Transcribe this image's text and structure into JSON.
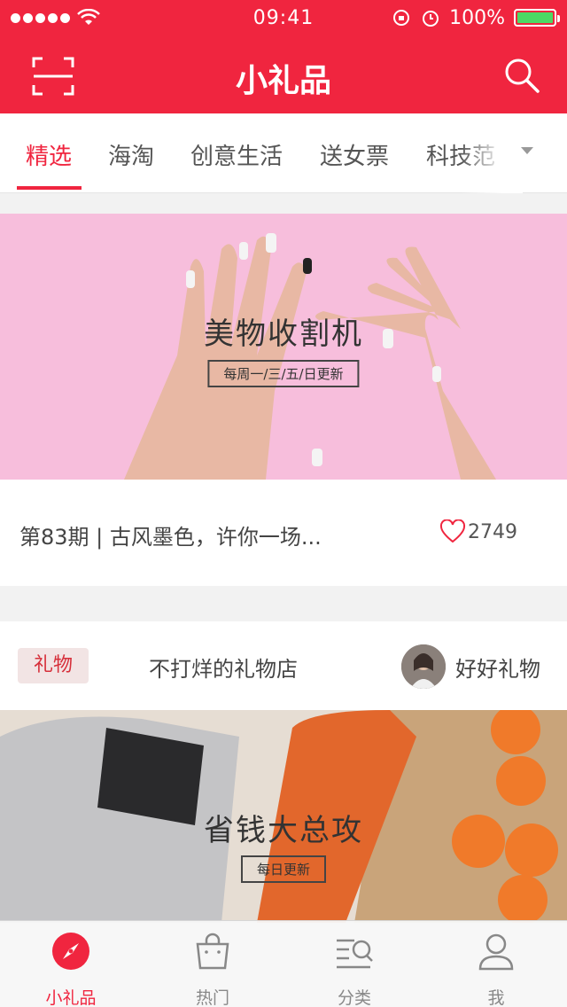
{
  "status_bar": {
    "time": "09:41",
    "battery": "100%"
  },
  "nav": {
    "title": "小礼品"
  },
  "tabs": [
    {
      "label": "精选",
      "active": true
    },
    {
      "label": "海淘"
    },
    {
      "label": "创意生活"
    },
    {
      "label": "送女票"
    },
    {
      "label": "科技范"
    }
  ],
  "feature": {
    "banner_title": "美物收割机",
    "banner_tag": "每周一/三/五/日更新",
    "title": "第83期 | 古风墨色，许你一场...",
    "likes": "2749"
  },
  "post": {
    "badge": "礼物",
    "shop": "不打烊的礼物店",
    "author": "好好礼物",
    "banner_title": "省钱大总攻",
    "banner_tag": "每日更新"
  },
  "tab_bar": [
    {
      "label": "小礼品",
      "icon": "compass-icon",
      "active": true
    },
    {
      "label": "热门",
      "icon": "shopping-bag-icon"
    },
    {
      "label": "分类",
      "icon": "category-search-icon"
    },
    {
      "label": "我",
      "icon": "person-icon"
    }
  ],
  "colors": {
    "brand": "#f0253f",
    "banner1_bg": "#f7bedc"
  }
}
